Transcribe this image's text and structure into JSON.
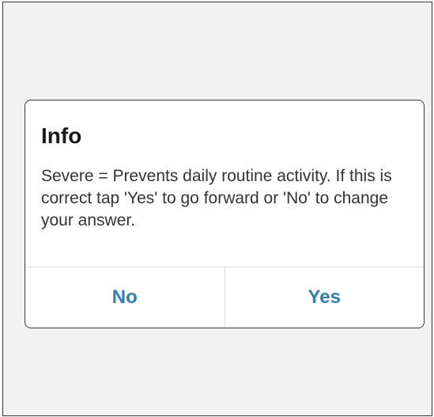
{
  "dialog": {
    "title": "Info",
    "message": "Severe = Prevents daily routine activity. If this is correct tap 'Yes' to go forward or 'No' to change your answer.",
    "no_label": "No",
    "yes_label": "Yes"
  },
  "colors": {
    "background": "#f2f2f2",
    "dialog_background": "#ffffff",
    "button_text": "#2e7fb0",
    "title_text": "#1a1a1a",
    "body_text": "#333333"
  }
}
